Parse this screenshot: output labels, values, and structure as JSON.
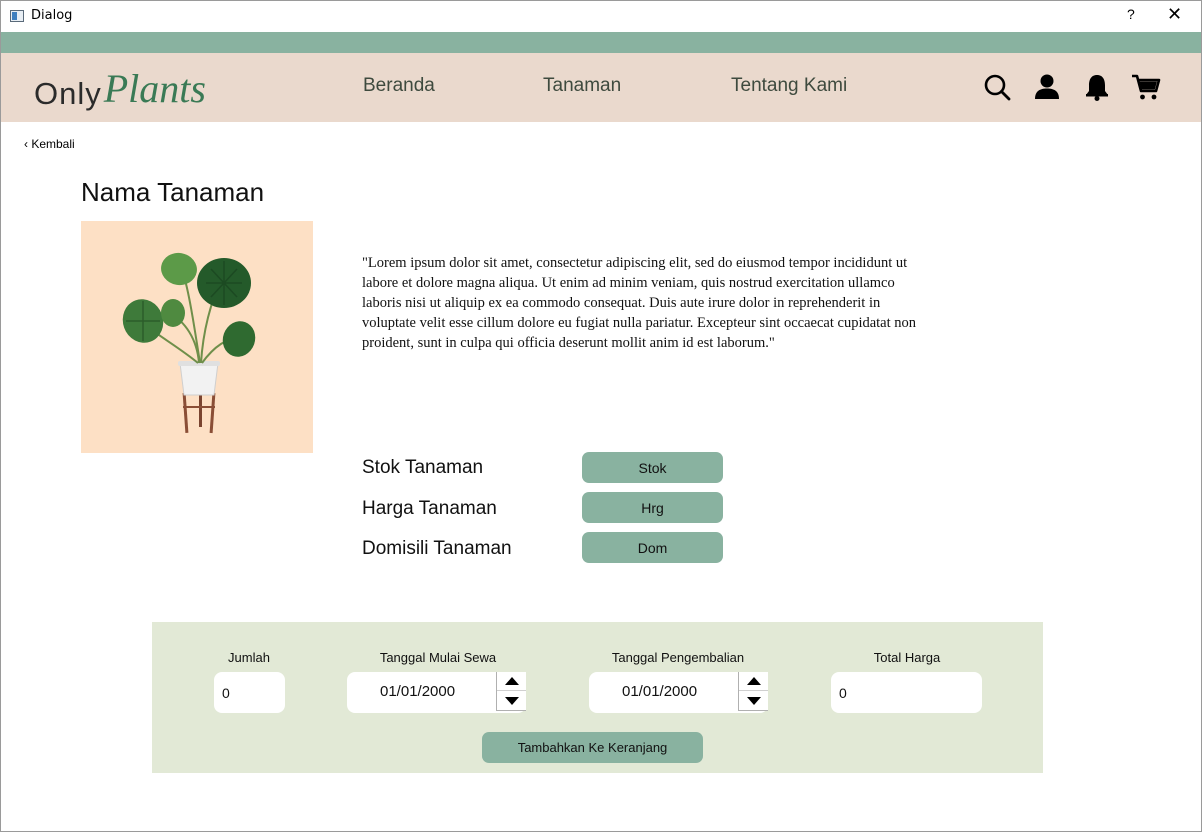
{
  "window": {
    "title": "Dialog",
    "help_label": "?",
    "close_label": "✕"
  },
  "colors": {
    "accent": "#89b2a0",
    "navbar_bg": "#ead9cd",
    "panel_bg": "#e2e9d6",
    "image_bg": "#fde0c5",
    "logo_green": "#3a7a55"
  },
  "logo": {
    "part1": "Only",
    "part2": "Plants"
  },
  "nav": {
    "beranda": "Beranda",
    "tanaman": "Tanaman",
    "tentang": "Tentang Kami"
  },
  "icons": {
    "search": "search-icon",
    "user": "user-icon",
    "bell": "bell-icon",
    "cart": "cart-icon"
  },
  "back_label": "‹ Kembali",
  "page_title": "Nama Tanaman",
  "description": "\"Lorem ipsum dolor sit amet, consectetur adipiscing elit, sed do eiusmod tempor incididunt ut labore et dolore magna aliqua. Ut enim ad minim veniam, quis nostrud exercitation ullamco laboris nisi ut aliquip ex ea commodo consequat. Duis aute irure dolor in reprehenderit in voluptate velit esse cillum dolore eu fugiat nulla pariatur. Excepteur sint occaecat cupidatat non proident, sunt in culpa qui officia deserunt mollit anim id est laborum.\"",
  "info": {
    "stok_label": "Stok Tanaman",
    "stok_value": "Stok",
    "harga_label": "Harga Tanaman",
    "harga_value": "Hrg",
    "domisili_label": "Domisili Tanaman",
    "domisili_value": "Dom"
  },
  "order": {
    "jumlah_label": "Jumlah",
    "jumlah_value": "0",
    "mulai_label": "Tanggal Mulai Sewa",
    "mulai_value": "01/01/2000",
    "kembali_label": "Tanggal Pengembalian",
    "kembali_value": "01/01/2000",
    "total_label": "Total Harga",
    "total_value": "0",
    "add_button": "Tambahkan Ke Keranjang"
  }
}
